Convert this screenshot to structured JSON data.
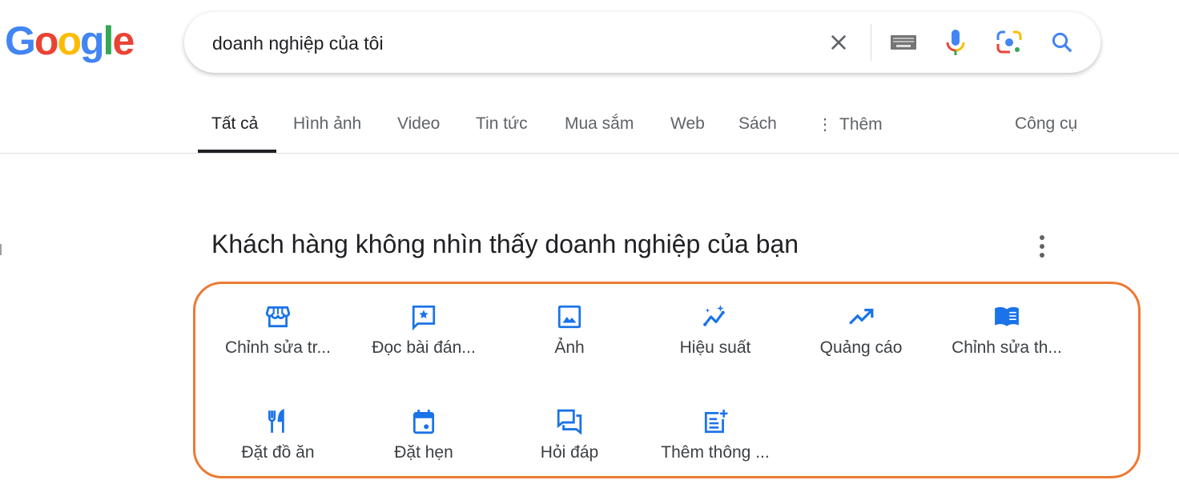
{
  "logo": "Google",
  "search": {
    "query": "doanh nghiệp của tôi",
    "icons": [
      "clear-icon",
      "keyboard-icon",
      "microphone-icon",
      "google-lens-icon",
      "search-icon"
    ]
  },
  "tabs": [
    {
      "label": "Tất cả",
      "active": true
    },
    {
      "label": "Hình ảnh"
    },
    {
      "label": "Video"
    },
    {
      "label": "Tin tức"
    },
    {
      "label": "Mua sắm"
    },
    {
      "label": "Web"
    },
    {
      "label": "Sách"
    },
    {
      "label": "Thêm"
    }
  ],
  "tools": "Công cụ",
  "panel": {
    "title": "Khách hàng không nhìn thấy doanh nghiệp của bạn",
    "accent": "#1a73e8",
    "highlight": "#ec7a33",
    "items": [
      {
        "label": "Chỉnh sửa tr...",
        "icon": "storefront-icon"
      },
      {
        "label": "Đọc bài đán...",
        "icon": "review-icon"
      },
      {
        "label": "Ảnh",
        "icon": "photo-icon"
      },
      {
        "label": "Hiệu suất",
        "icon": "performance-icon"
      },
      {
        "label": "Quảng cáo",
        "icon": "trending-up-icon"
      },
      {
        "label": "Chỉnh sửa th...",
        "icon": "menu-book-icon"
      },
      {
        "label": "Đặt đồ ăn",
        "icon": "restaurant-icon"
      },
      {
        "label": "Đặt hẹn",
        "icon": "calendar-icon"
      },
      {
        "label": "Hỏi đáp",
        "icon": "forum-icon"
      },
      {
        "label": "Thêm thông ...",
        "icon": "post-add-icon"
      }
    ]
  }
}
